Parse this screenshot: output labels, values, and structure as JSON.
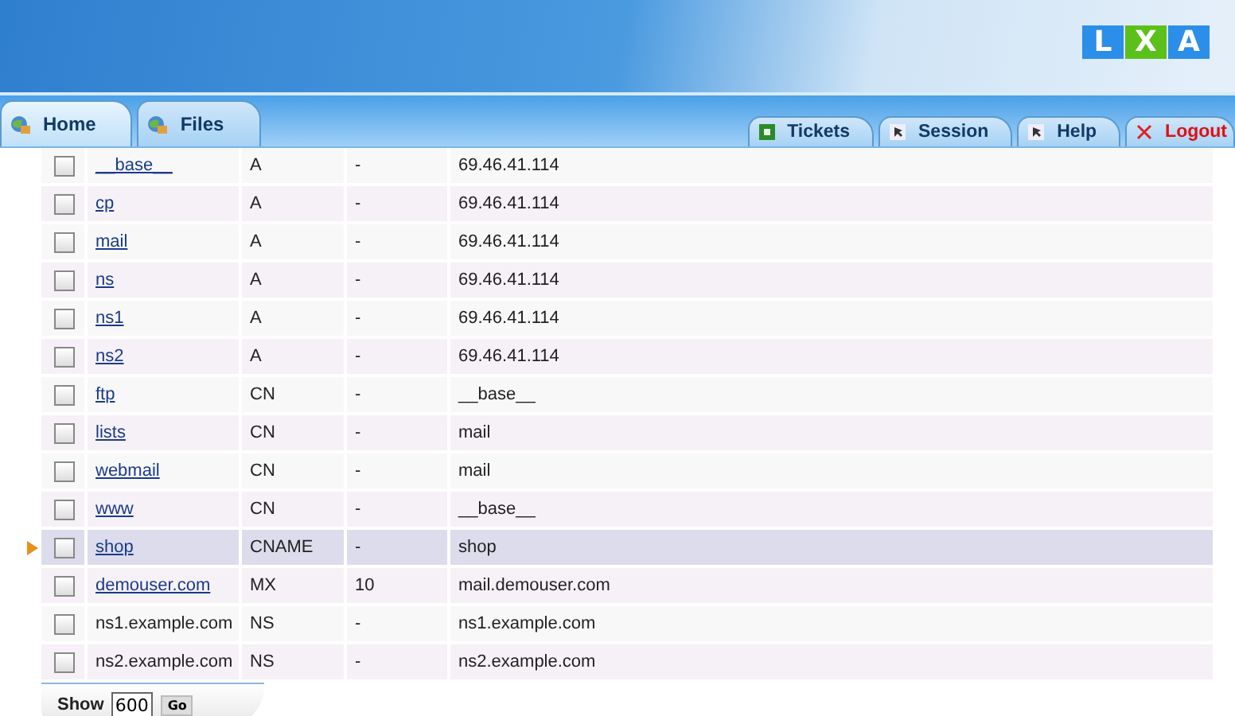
{
  "logo": {
    "letters": [
      "L",
      "X",
      "A"
    ]
  },
  "tabs_left": [
    {
      "label": "Home",
      "selected": true
    },
    {
      "label": "Files",
      "selected": false
    }
  ],
  "tabs_right": [
    {
      "label": "Tickets",
      "kind": "tickets"
    },
    {
      "label": "Session",
      "kind": "page"
    },
    {
      "label": "Help",
      "kind": "page"
    },
    {
      "label": "Logout",
      "kind": "logout"
    }
  ],
  "table": {
    "rows": [
      {
        "name": "__base__",
        "link": true,
        "type": "A",
        "priority": "-",
        "value": "69.46.41.114",
        "checked": false,
        "selected": false
      },
      {
        "name": "cp",
        "link": true,
        "type": "A",
        "priority": "-",
        "value": "69.46.41.114",
        "checked": false,
        "selected": false
      },
      {
        "name": "mail",
        "link": true,
        "type": "A",
        "priority": "-",
        "value": "69.46.41.114",
        "checked": false,
        "selected": false
      },
      {
        "name": "ns",
        "link": true,
        "type": "A",
        "priority": "-",
        "value": "69.46.41.114",
        "checked": false,
        "selected": false
      },
      {
        "name": "ns1",
        "link": true,
        "type": "A",
        "priority": "-",
        "value": "69.46.41.114",
        "checked": false,
        "selected": false
      },
      {
        "name": "ns2",
        "link": true,
        "type": "A",
        "priority": "-",
        "value": "69.46.41.114",
        "checked": false,
        "selected": false
      },
      {
        "name": "ftp",
        "link": true,
        "type": "CN",
        "priority": "-",
        "value": "__base__",
        "checked": false,
        "selected": false
      },
      {
        "name": "lists",
        "link": true,
        "type": "CN",
        "priority": "-",
        "value": "mail",
        "checked": false,
        "selected": false
      },
      {
        "name": "webmail",
        "link": true,
        "type": "CN",
        "priority": "-",
        "value": "mail",
        "checked": false,
        "selected": false
      },
      {
        "name": "www",
        "link": true,
        "type": "CN",
        "priority": "-",
        "value": "__base__",
        "checked": false,
        "selected": false
      },
      {
        "name": "shop",
        "link": true,
        "type": "CNAME",
        "priority": "-",
        "value": "shop",
        "checked": false,
        "selected": true
      },
      {
        "name": "demouser.com",
        "link": true,
        "type": "MX",
        "priority": "10",
        "value": "mail.demouser.com",
        "checked": false,
        "selected": false
      },
      {
        "name": "ns1.example.com",
        "link": false,
        "type": "NS",
        "priority": "-",
        "value": "ns1.example.com",
        "checked": false,
        "selected": false
      },
      {
        "name": "ns2.example.com",
        "link": false,
        "type": "NS",
        "priority": "-",
        "value": "ns2.example.com",
        "checked": false,
        "selected": false
      }
    ]
  },
  "footer": {
    "label": "Show",
    "count": "600",
    "button": "Go"
  }
}
